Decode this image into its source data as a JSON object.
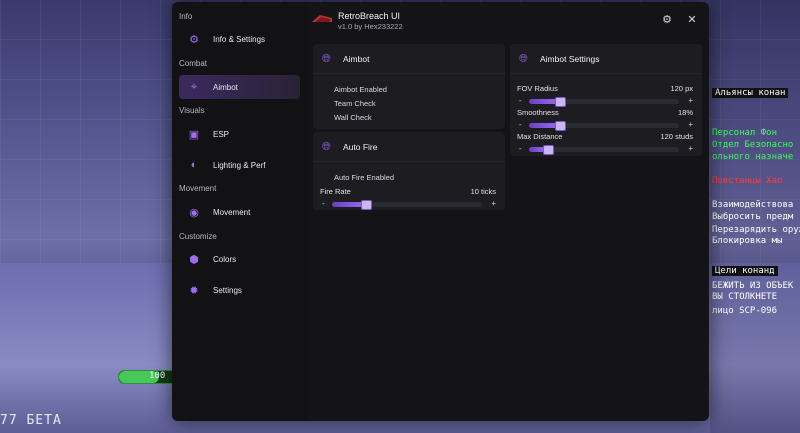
{
  "app": {
    "title": "RetroBreach UI",
    "version": "v1.0 by Hex233222"
  },
  "sidebar": {
    "sections": [
      {
        "label": "Info",
        "items": [
          {
            "label": "Info & Settings",
            "icon": "gear-box-icon",
            "active": false
          }
        ]
      },
      {
        "label": "Combat",
        "items": [
          {
            "label": "Aimbot",
            "icon": "crosshair-icon",
            "active": true
          }
        ]
      },
      {
        "label": "Visuals",
        "items": [
          {
            "label": "ESP",
            "icon": "box-icon",
            "active": false
          },
          {
            "label": "Lighting & Perf",
            "icon": "bulb-icon",
            "active": false
          }
        ]
      },
      {
        "label": "Movement",
        "items": [
          {
            "label": "Movement",
            "icon": "eye-icon",
            "active": false
          }
        ]
      },
      {
        "label": "Customize",
        "items": [
          {
            "label": "Colors",
            "icon": "pin-icon",
            "active": false
          },
          {
            "label": "Settings",
            "icon": "gear-icon",
            "active": false
          }
        ]
      }
    ]
  },
  "aimbot_card": {
    "title": "Aimbot",
    "options": [
      "Aimbot Enabled",
      "Team Check",
      "Wall Check"
    ]
  },
  "autofire_card": {
    "title": "Auto Fire",
    "options": [
      "Auto Fire Enabled"
    ],
    "slider": {
      "label": "Fire Rate",
      "value": "10 ticks",
      "fraction": 0.22
    }
  },
  "aimbot_settings_card": {
    "title": "Aimbot Settings",
    "sliders": [
      {
        "label": "FOV Radius",
        "value": "120 px",
        "fraction": 0.2
      },
      {
        "label": "Smoothness",
        "value": "18%",
        "fraction": 0.2
      },
      {
        "label": "Max Distance",
        "value": "120 studs",
        "fraction": 0.12
      }
    ]
  },
  "background": {
    "right_panel_lines": [
      {
        "text": "Альянсы конан",
        "style": "black"
      },
      {
        "text": "Персонал Фон",
        "style": "green"
      },
      {
        "text": "Отдел Безопасно",
        "style": "green"
      },
      {
        "text": "ольного назначе",
        "style": "green"
      },
      {
        "text": "Повстанцы Хао",
        "style": "red"
      },
      {
        "text": "Взаимодействова",
        "style": "white"
      },
      {
        "text": "Выбросить предм",
        "style": "white"
      },
      {
        "text": "Перезарядить оруж",
        "style": "white"
      },
      {
        "text": "Блокировка мы",
        "style": "white"
      },
      {
        "text": "Цели конанд",
        "style": "black"
      },
      {
        "text": "БЕЖИТЬ ИЗ ОБЪЕК",
        "style": "white"
      },
      {
        "text": "ВЫ СТОЛКНЕТЕ",
        "style": "white"
      },
      {
        "text": "лицо SCP-096",
        "style": "white"
      }
    ],
    "health_value": "100",
    "beta_label": "77 БЕТА"
  },
  "colors": {
    "accent": "#8a5bd8",
    "panel": "#1c1c21",
    "window": "#141418"
  }
}
